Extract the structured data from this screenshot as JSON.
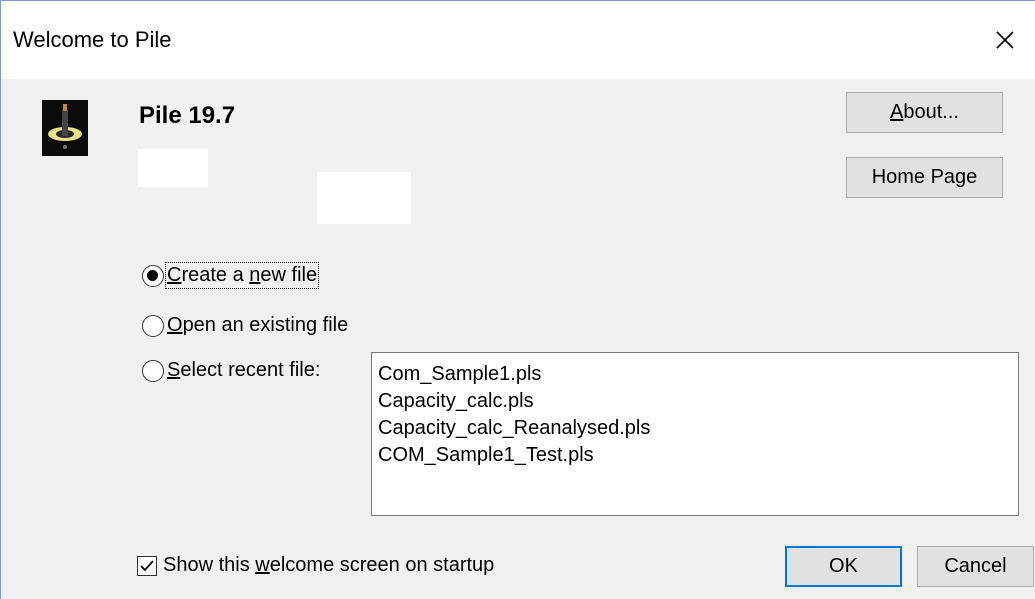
{
  "window": {
    "title": "Welcome to Pile",
    "close_icon": "close-icon"
  },
  "header": {
    "app_icon": "pile-app-icon",
    "app_name": "Pile 19.7"
  },
  "buttons": {
    "about_prefix": "",
    "about_mnemonic": "A",
    "about_rest": "bout...",
    "home_page": "Home Page",
    "ok": "OK",
    "cancel": "Cancel"
  },
  "options": [
    {
      "pre": "",
      "mnemonic": "C",
      "mid": "reate a ",
      "mnemonic2": "n",
      "post": "ew file",
      "checked": true
    },
    {
      "pre": "",
      "mnemonic": "O",
      "post": "pen an existing file",
      "checked": false
    },
    {
      "pre": "",
      "mnemonic": "S",
      "post": "elect recent file:",
      "checked": false
    }
  ],
  "recent_files": [
    "Com_Sample1.pls",
    "Capacity_calc.pls",
    "Capacity_calc_Reanalysed.pls",
    "COM_Sample1_Test.pls"
  ],
  "startup": {
    "pre": "Show this ",
    "mnemonic": "w",
    "post": "elcome screen on startup",
    "checked": true
  },
  "colors": {
    "focus_border": "#0078d7",
    "dialog_bg": "#f0f0f0"
  }
}
